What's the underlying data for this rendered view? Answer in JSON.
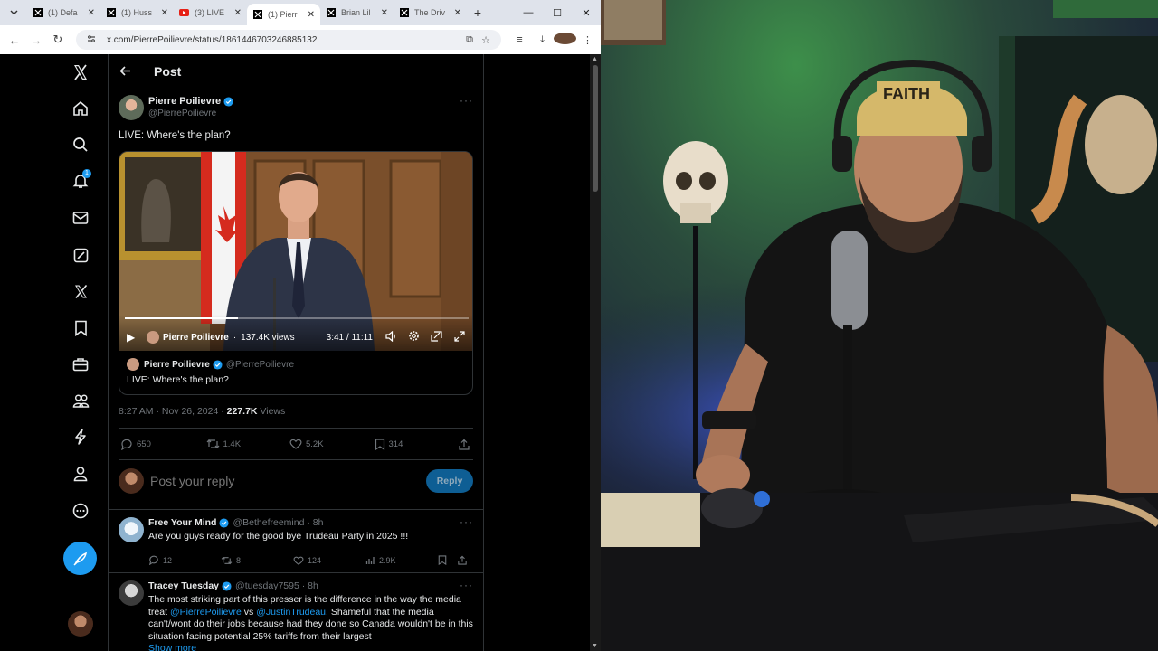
{
  "browser": {
    "tabs": [
      {
        "title": "(1) Defa",
        "icon": "x-logo-icon",
        "active": false
      },
      {
        "title": "(1) Huss",
        "icon": "x-logo-icon",
        "active": false
      },
      {
        "title": "(3) LIVE",
        "icon": "youtube-icon",
        "active": false
      },
      {
        "title": "(1) Pierr",
        "icon": "x-logo-icon",
        "active": true
      },
      {
        "title": "Brian Lil",
        "icon": "x-logo-icon",
        "active": false
      },
      {
        "title": "The Driv",
        "icon": "x-logo-icon",
        "active": false
      }
    ],
    "url": "x.com/PierrePoilievre/status/1861446703246885132"
  },
  "nav": {
    "notification_count": "1"
  },
  "header": {
    "title": "Post"
  },
  "post": {
    "author_name": "Pierre Poilievre",
    "author_handle": "@PierrePoilievre",
    "text": "LIVE: Where's the plan?",
    "video": {
      "channel": "Pierre Poilievre",
      "views": "137.4K views",
      "time": "3:41 / 11:11",
      "progress": 0.33
    },
    "quote": {
      "name": "Pierre Poilievre",
      "handle": "@PierrePoilievre",
      "text": "LIVE: Where's the plan?"
    },
    "timestamp": "8:27 AM · Nov 26, 2024 · ",
    "views_count": "227.7K",
    "views_label": " Views",
    "stats": {
      "replies": "650",
      "reposts": "1.4K",
      "likes": "5.2K",
      "bookmarks": "314"
    }
  },
  "reply_box": {
    "placeholder": "Post your reply",
    "button": "Reply"
  },
  "replies": [
    {
      "name": "Free Your Mind",
      "handle": "@Bethefreemind · 8h",
      "text": "Are you guys ready for the good bye Trudeau Party in 2025 !!!",
      "replies": "12",
      "reposts": "8",
      "likes": "124",
      "views": "2.9K"
    },
    {
      "name": "Tracey Tuesday",
      "handle": "@tuesday7595 · 8h",
      "text_1": "The most striking part of this presser is the difference in the way the media treat ",
      "mention_1": "@PierrePoilievre",
      "text_2": " vs ",
      "mention_2": "@JustinTrudeau",
      "text_3": ". Shameful that the media can't/wont do their jobs because had they done so Canada wouldn't be in this situation facing potential 25% tariffs from their largest",
      "show_more": "Show more"
    }
  ],
  "colors": {
    "accent": "#1d9bf0",
    "background": "#000000",
    "text": "#e7e9ea",
    "muted": "#71767b"
  }
}
